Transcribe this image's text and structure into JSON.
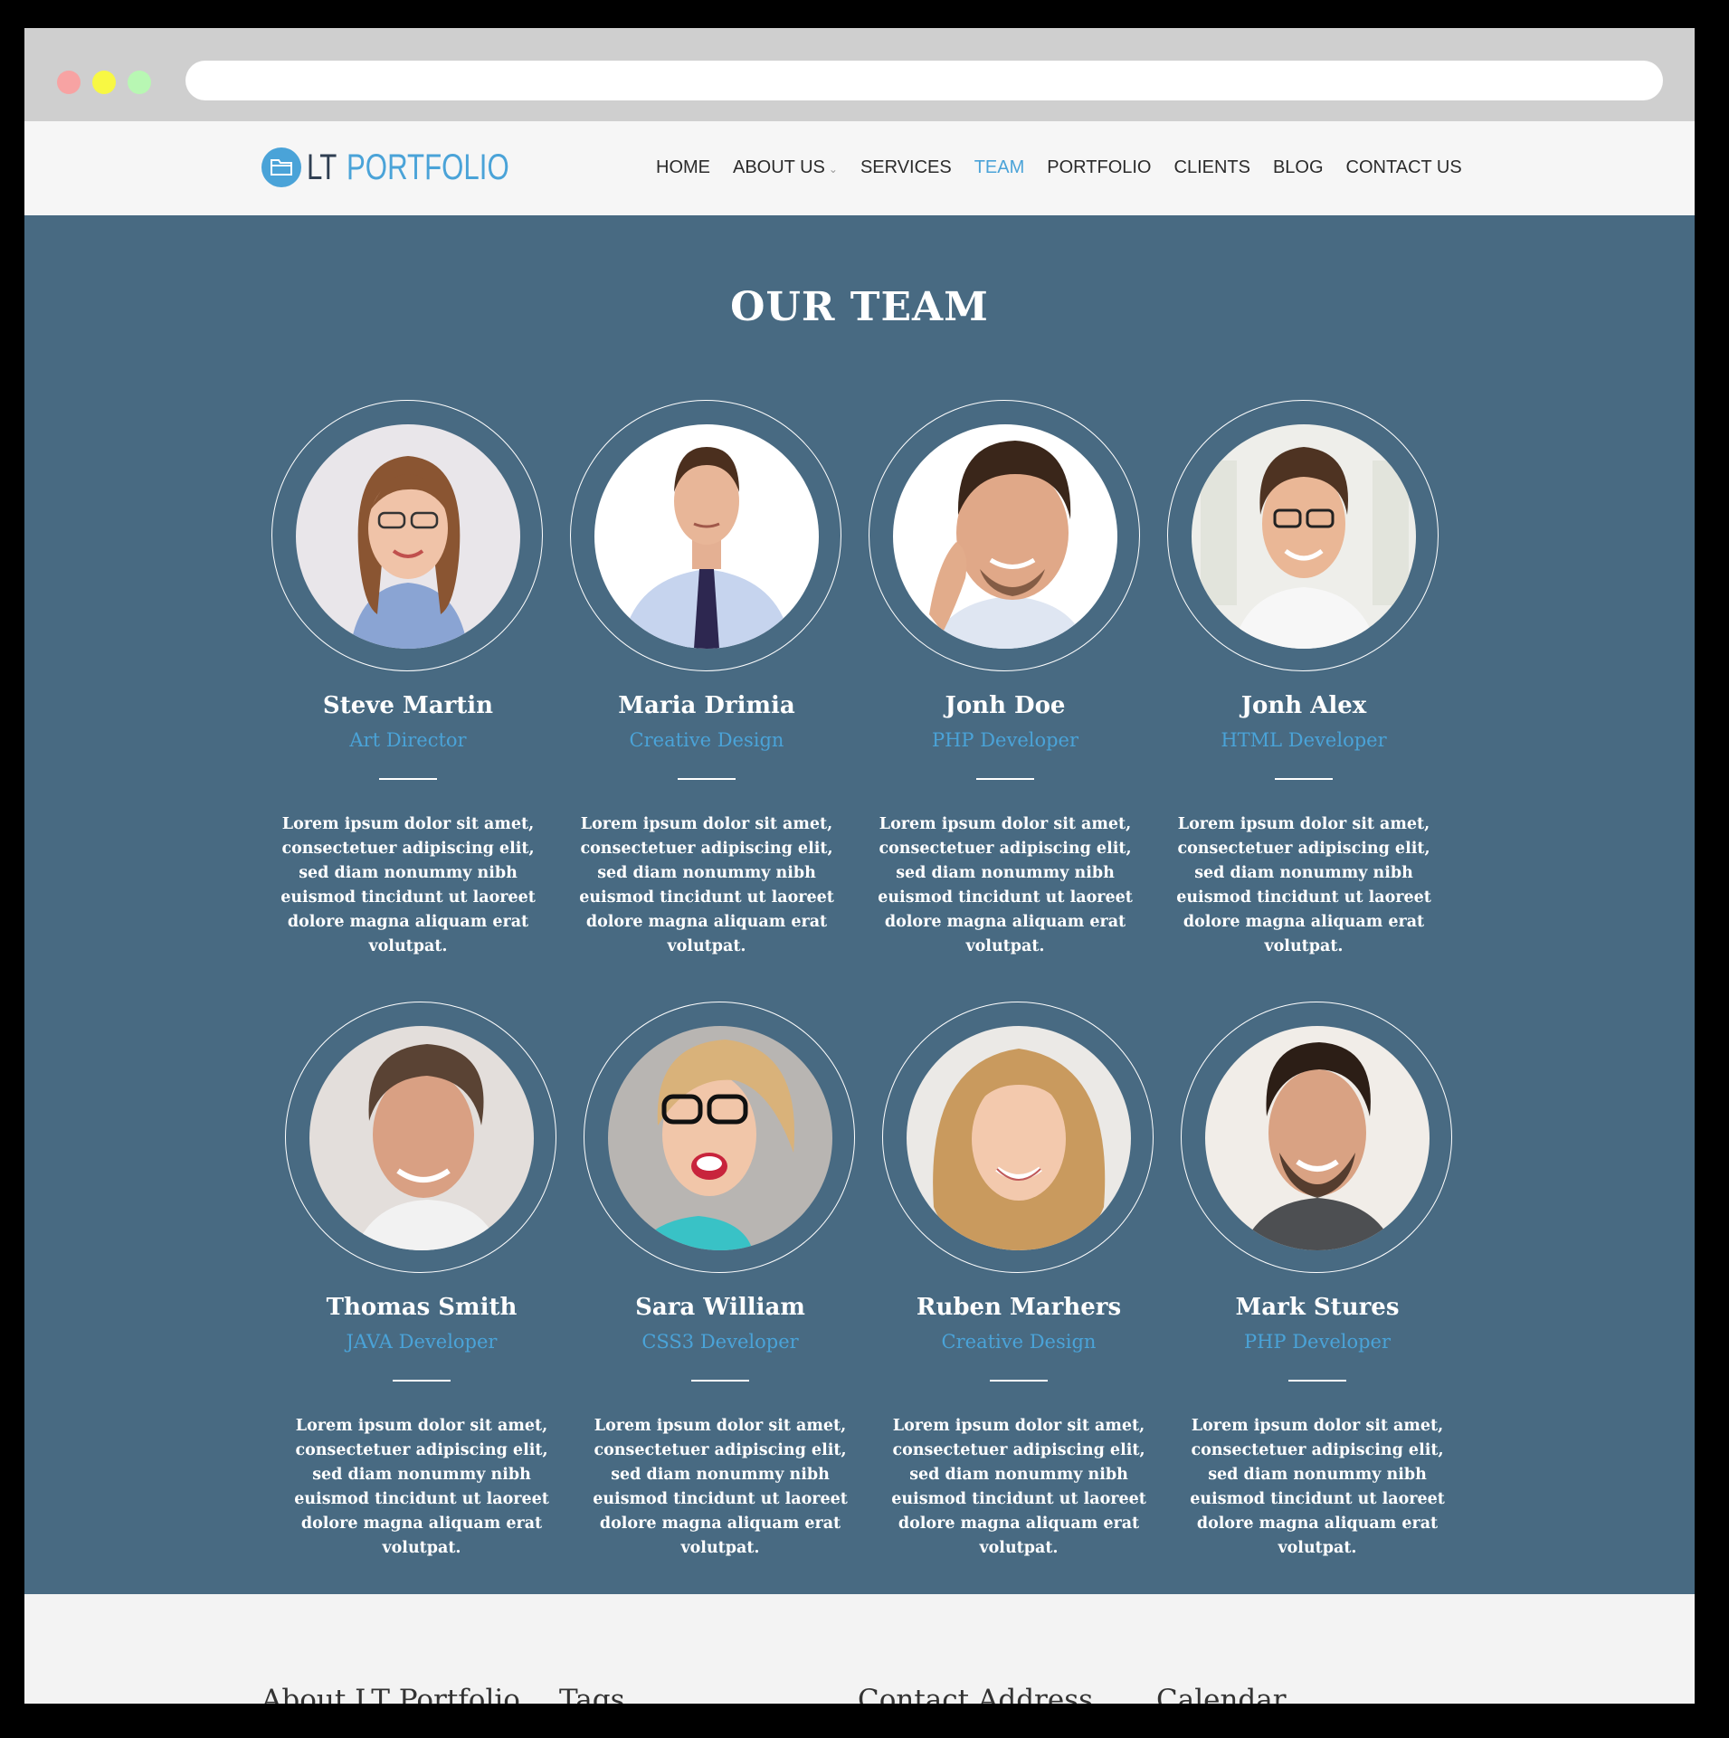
{
  "nav": {
    "logo_lt": "LT",
    "logo_portfolio": "PORTFOLIO",
    "items": [
      "HOME",
      "ABOUT US",
      "SERVICES",
      "TEAM",
      "PORTFOLIO",
      "CLIENTS",
      "BLOG",
      "CONTACT US"
    ],
    "active": "TEAM"
  },
  "team": {
    "title": "OUR TEAM",
    "members": [
      {
        "name": "Steve Martin",
        "role": "Art Director",
        "bio": "Lorem ipsum dolor sit amet, consectetuer adipiscing elit, sed diam nonummy nibh euismod tincidunt ut laoreet dolore magna aliquam erat volutpat."
      },
      {
        "name": "Maria Drimia",
        "role": "Creative Design",
        "bio": "Lorem ipsum dolor sit amet, consectetuer adipiscing elit, sed diam nonummy nibh euismod tincidunt ut laoreet dolore magna aliquam erat volutpat."
      },
      {
        "name": "Jonh Doe",
        "role": "PHP Developer",
        "bio": "Lorem ipsum dolor sit amet, consectetuer adipiscing elit, sed diam nonummy nibh euismod tincidunt ut laoreet dolore magna aliquam erat volutpat."
      },
      {
        "name": "Jonh Alex",
        "role": "HTML Developer",
        "bio": "Lorem ipsum dolor sit amet, consectetuer adipiscing elit, sed diam nonummy nibh euismod tincidunt ut laoreet dolore magna aliquam erat volutpat."
      },
      {
        "name": "Thomas Smith",
        "role": "JAVA Developer",
        "bio": "Lorem ipsum dolor sit amet, consectetuer adipiscing elit, sed diam nonummy nibh euismod tincidunt ut laoreet dolore magna aliquam erat volutpat."
      },
      {
        "name": "Sara William",
        "role": "CSS3 Developer",
        "bio": "Lorem ipsum dolor sit amet, consectetuer adipiscing elit, sed diam nonummy nibh euismod tincidunt ut laoreet dolore magna aliquam erat volutpat."
      },
      {
        "name": "Ruben Marhers",
        "role": "Creative Design",
        "bio": "Lorem ipsum dolor sit amet, consectetuer adipiscing elit, sed diam nonummy nibh euismod tincidunt ut laoreet dolore magna aliquam erat volutpat."
      },
      {
        "name": "Mark Stures",
        "role": "PHP Developer",
        "bio": "Lorem ipsum dolor sit amet, consectetuer adipiscing elit, sed diam nonummy nibh euismod tincidunt ut laoreet dolore magna aliquam erat volutpat."
      }
    ]
  },
  "footer": {
    "headings": [
      "About LT Portfolio",
      "Tags",
      "Contact Address",
      "Calendar"
    ]
  },
  "colors": {
    "accent": "#4aa3d8",
    "section_bg": "#486a82",
    "header_bg": "#f6f6f6",
    "footer_bg": "#f3f3f3"
  }
}
